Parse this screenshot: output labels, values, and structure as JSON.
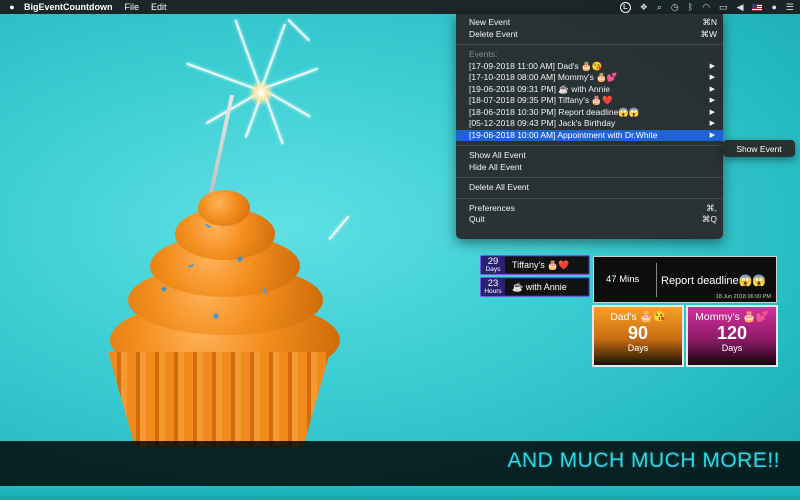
{
  "menubar": {
    "app_name": "BigEventCountdown",
    "menus": [
      "File",
      "Edit"
    ],
    "status_app_letter": "L"
  },
  "dropdown": {
    "new_event": "New Event",
    "new_event_shortcut": "⌘N",
    "delete_event": "Delete Event",
    "delete_event_shortcut": "⌘W",
    "events_header": "Events:",
    "events": [
      "[17-09-2018 11:00 AM] Dad's 🎂😘",
      "[17-10-2018 08:00 AM] Mommy's 🎂💕",
      "[19-06-2018 09:31 PM] ☕ with Annie",
      "[18-07-2018 09:35 PM] Tiffany's 🎂❤️",
      "[18-06-2018 10:30 PM] Report deadline😱😱",
      "[05-12-2018 09:43 PM] Jack's Birthday",
      "[19-06-2018 10:00 AM] Appointment with Dr.White"
    ],
    "show_all": "Show All Event",
    "hide_all": "Hide All Event",
    "delete_all": "Delete All Event",
    "preferences": "Preferences",
    "preferences_shortcut": "⌘,",
    "quit": "Quit",
    "quit_shortcut": "⌘Q",
    "submenu_show_event": "Show Event"
  },
  "widgets": {
    "tiffany": {
      "number": "29",
      "unit": "Days",
      "label": "Tiffany's 🎂❤️"
    },
    "annie": {
      "number": "23",
      "unit": "Hours",
      "label": "☕ with Annie"
    },
    "report": {
      "value": "47 Mins",
      "title": "Report deadline😱😱",
      "date": "18 Jun 2018 06:00 PM"
    },
    "dad": {
      "title": "Dad's 🎂😘",
      "value": "90",
      "unit": "Days"
    },
    "mommy": {
      "title": "Mommy's 🎂💕",
      "value": "120",
      "unit": "Days"
    }
  },
  "banner": {
    "text": "AND MUCH MUCH MORE!!"
  }
}
